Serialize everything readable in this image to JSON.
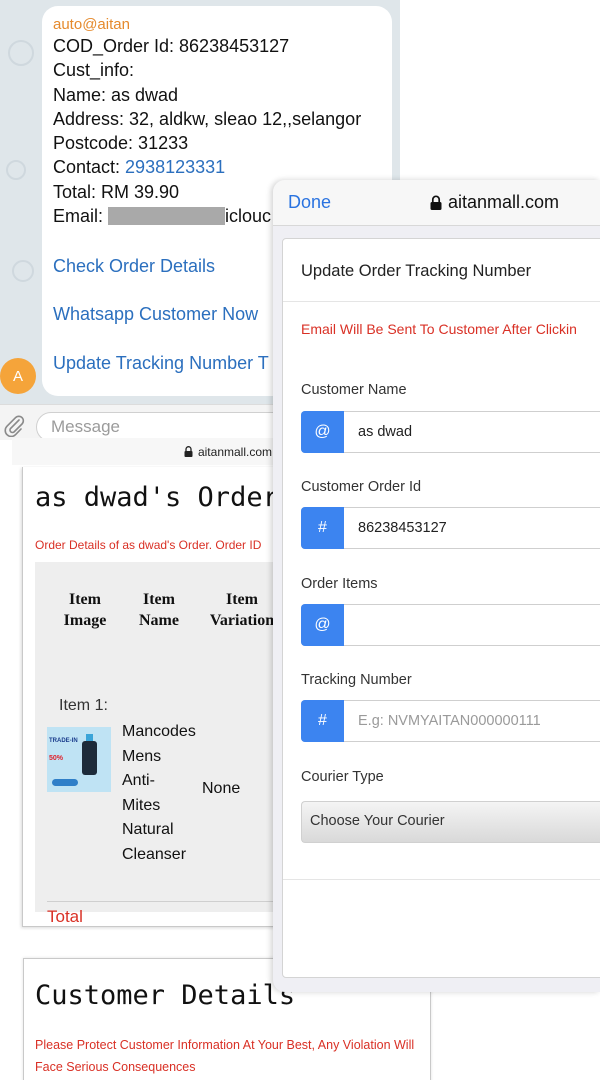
{
  "chat": {
    "sender": "auto@aitan",
    "order_line": "COD_Order Id: 86238453127",
    "cust_info_label": "Cust_info:",
    "name_line": "Name: as dwad",
    "address_line": "Address: 32, aldkw, sleao 12,,selangor",
    "postcode_line": "Postcode: 31233",
    "contact_label": "Contact: ",
    "contact_value": "2938123331",
    "total_line": "Total: RM 39.90",
    "email_label": "Email: ",
    "email_suffix": "iclouc",
    "links": {
      "check_order": "Check Order Details",
      "whatsapp": "Whatsapp Customer Now",
      "update_tracking": "Update Tracking Number T"
    },
    "avatar_letter": "A",
    "message_placeholder": "Message"
  },
  "order_page": {
    "url": "aitanmall.com",
    "title": "as dwad's Order D",
    "subtitle": "Order Details of as dwad's Order. Order ID",
    "headers": {
      "item_image": [
        "Item",
        "Image"
      ],
      "item_name": [
        "Item",
        "Name"
      ],
      "item_variation": [
        "Item",
        "Variation"
      ]
    },
    "item_label": "Item 1:",
    "product_tag": "TRADE-IN",
    "product_percent": "50%",
    "item_name_lines": [
      "Mancodes",
      "Mens",
      "Anti-",
      "Mites",
      "Natural",
      "Cleanser"
    ],
    "item_variation": "None",
    "total_label": "Total"
  },
  "customer_details": {
    "title": "Customer Details",
    "note": "Please Protect Customer Information At Your Best, Any Violation Will Face Serious Consequences"
  },
  "safari": {
    "done_label": "Done",
    "url": "aitanmall.com",
    "modal_title": "Update Order Tracking Number",
    "warning": "Email Will Be Sent To Customer After Clickin",
    "fields": {
      "customer_name_label": "Customer Name",
      "customer_name_addon": "@",
      "customer_name_value": "as dwad",
      "order_id_label": "Customer Order Id",
      "order_id_addon": "#",
      "order_id_value": "86238453127",
      "order_items_label": "Order Items",
      "order_items_addon": "@",
      "order_items_value": "",
      "tracking_label": "Tracking Number",
      "tracking_addon": "#",
      "tracking_placeholder": "E.g: NVMYAITAN000000111",
      "courier_label": "Courier Type",
      "courier_value": "Choose Your Courier"
    }
  },
  "colors": {
    "link_blue": "#2b6fbe",
    "addon_blue": "#3c84f0",
    "warning_red": "#d93025",
    "sender_orange": "#e58a2d"
  },
  "icons": [
    "lock-icon",
    "paperclip-icon",
    "avatar"
  ]
}
